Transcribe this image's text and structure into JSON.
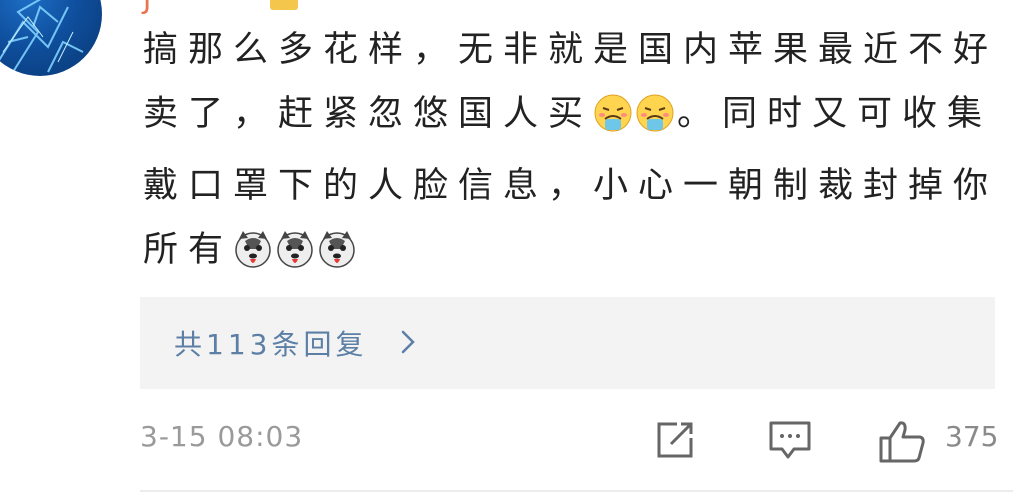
{
  "comment": {
    "username": "J",
    "text_parts": [
      "搞那么多花样，无非就是国内苹果最近不好卖了，赶紧忽悠国人买",
      "。同时又可收集戴口罩下的人脸信息，小心一朝制裁封掉你所有"
    ],
    "emojis": {
      "after_part1": [
        "tired-face-icon",
        "tired-face-icon"
      ],
      "after_part2": [
        "husky-icon",
        "husky-icon",
        "husky-icon"
      ]
    },
    "replies_label": "共113条回复",
    "timestamp": "3-15 08:03",
    "like_count": "375"
  },
  "colors": {
    "text": "#222222",
    "link": "#5c7fa6",
    "muted": "#9a9a9a",
    "reply_bg": "#f3f3f3",
    "username": "#eb7350"
  }
}
